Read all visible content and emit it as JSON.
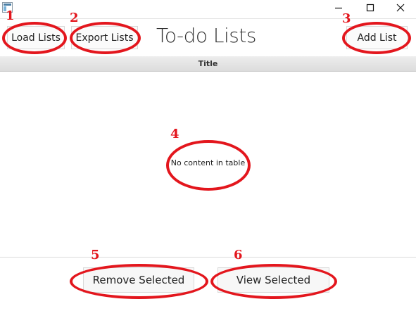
{
  "window": {
    "controls": {
      "minimize_icon": "minimize-icon",
      "maximize_icon": "maximize-icon",
      "close_icon": "close-icon"
    }
  },
  "toolbar": {
    "load_label": "Load Lists",
    "export_label": "Export Lists",
    "title": "To-do Lists",
    "add_label": "Add List"
  },
  "table": {
    "columns": [
      "Title"
    ],
    "empty_message": "No content in table"
  },
  "actions": {
    "remove_label": "Remove Selected",
    "view_label": "View Selected"
  },
  "annotations": {
    "color": "#e3161d",
    "numbers": [
      "1",
      "2",
      "3",
      "4",
      "5",
      "6"
    ]
  }
}
